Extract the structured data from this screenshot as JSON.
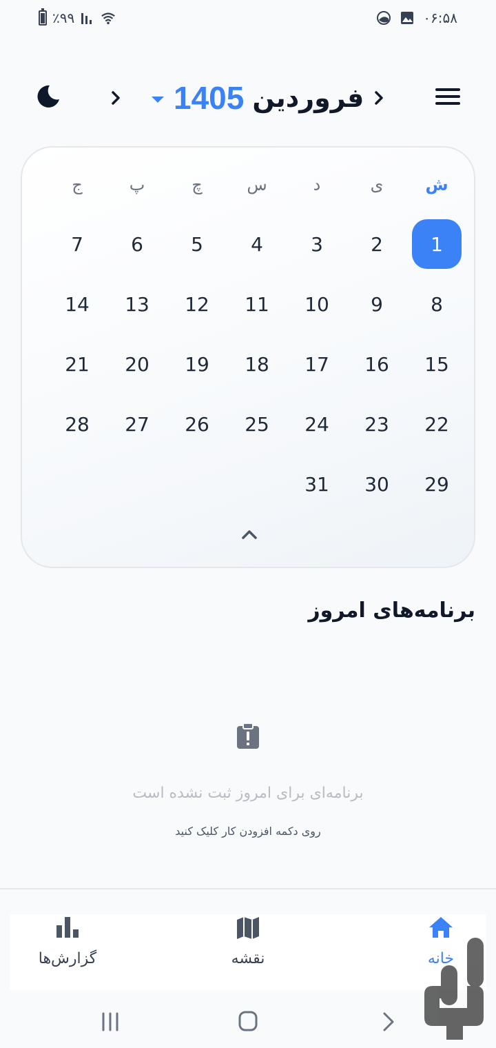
{
  "status_bar": {
    "time": "۰۶:۵۸",
    "battery": "٪۹۹"
  },
  "header": {
    "month": "فروردین",
    "year": "1405"
  },
  "calendar": {
    "weekdays": [
      "ش",
      "ی",
      "د",
      "س",
      "چ",
      "پ",
      "ج"
    ],
    "weeks": [
      [
        "1",
        "2",
        "3",
        "4",
        "5",
        "6",
        "7"
      ],
      [
        "8",
        "9",
        "10",
        "11",
        "12",
        "13",
        "14"
      ],
      [
        "15",
        "16",
        "17",
        "18",
        "19",
        "20",
        "21"
      ],
      [
        "22",
        "23",
        "24",
        "25",
        "26",
        "27",
        "28"
      ],
      [
        "29",
        "30",
        "31",
        "",
        "",
        "",
        ""
      ]
    ],
    "selected_day": "1"
  },
  "today_section": {
    "title": "برنامه‌های امروز",
    "empty_text": "برنامه‌ای برای امروز ثبت نشده است",
    "empty_hint": "روی دکمه افزودن کار کلیک کنید"
  },
  "bottom_nav": {
    "home": "خانه",
    "map": "نقشه",
    "reports": "گزارش‌ها"
  },
  "colors": {
    "accent": "#3b82f6",
    "text": "#111827",
    "muted": "#6b7280"
  }
}
